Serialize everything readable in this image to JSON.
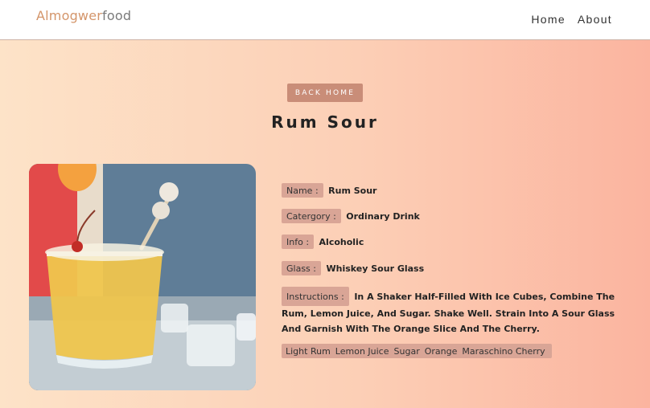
{
  "navbar": {
    "logo_part1": "Almogwer",
    "logo_part2": "food",
    "links": [
      "Home",
      "About"
    ]
  },
  "page": {
    "back_button": "BACK HOME",
    "title": "Rum Sour"
  },
  "drink": {
    "image_alt": "Rum Sour",
    "name_label": "Name :",
    "name": "Rum Sour",
    "category_label": "Catergory :",
    "category": "Ordinary Drink",
    "info_label": "Info :",
    "info": "Alcoholic",
    "glass_label": "Glass :",
    "glass": "Whiskey Sour Glass",
    "instructions_label": "Instructions :",
    "instructions": "In A Shaker Half-Filled With Ice Cubes, Combine The Rum, Lemon Juice, And Sugar. Shake Well. Strain Into A Sour Glass And Garnish With The Orange Slice And The Cherry.",
    "ingredients": [
      "Light Rum",
      "Lemon Juice",
      "Sugar",
      "Orange",
      "Maraschino Cherry"
    ]
  },
  "colors": {
    "logo_accent": "#d4956a",
    "button_bg": "#c98d78",
    "pill_bg": "#d9a596",
    "gradient_start": "#fde3c8",
    "gradient_end": "#fbb49f"
  }
}
